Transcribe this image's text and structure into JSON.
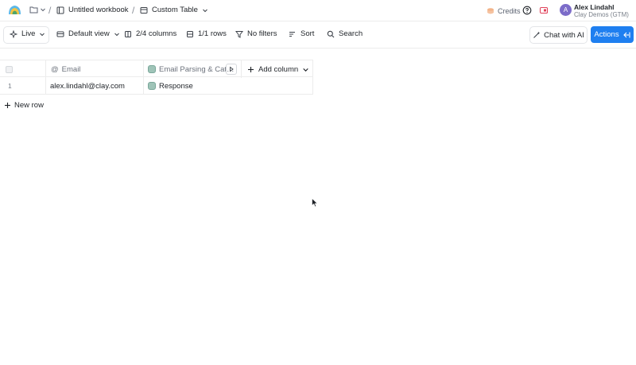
{
  "topbar": {
    "workbook_title": "Untitled workbook",
    "table_title": "Custom Table",
    "credits_label": "Credits",
    "user_name": "Alex Lindahl",
    "user_org": "Clay Demos (GTM)",
    "avatar_initial": "A"
  },
  "toolbar": {
    "live_label": "Live",
    "view_label": "Default view",
    "columns_label": "2/4 columns",
    "rows_label": "1/1 rows",
    "filters_label": "No filters",
    "sort_label": "Sort",
    "search_label": "Search",
    "chat_label": "Chat with AI",
    "actions_label": "Actions"
  },
  "table": {
    "columns": [
      {
        "label": "Email",
        "icon": "at-icon"
      },
      {
        "label": "Email Parsing & Cat…",
        "icon": "enrichment-icon"
      }
    ],
    "add_column_label": "Add column",
    "rows": [
      {
        "index": "1",
        "email": "alex.lindahl@clay.com",
        "response": "Response"
      }
    ],
    "new_row_label": "New row"
  },
  "colors": {
    "accent": "#1f7ff0",
    "avatar": "#7c6cc9",
    "enrichment_icon": "#9fc4b8"
  }
}
